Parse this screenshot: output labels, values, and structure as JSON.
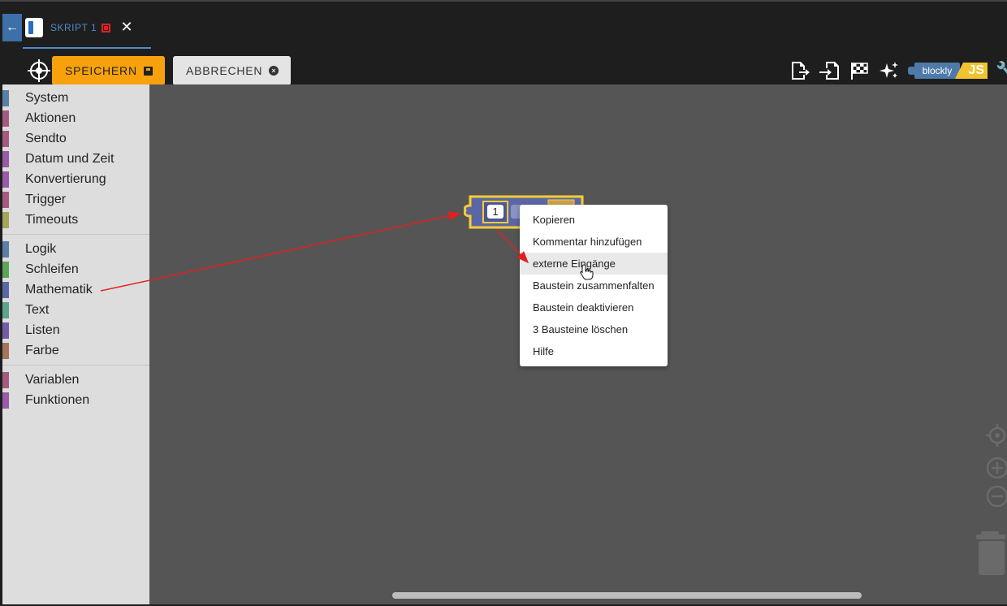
{
  "tab": {
    "title": "SKRIPT 1"
  },
  "toolbar": {
    "save_label": "SPEICHERN",
    "cancel_label": "ABBRECHEN",
    "blockly_label": "blockly",
    "js_label": "JS"
  },
  "sidebar": {
    "groups": [
      [
        {
          "label": "System",
          "color": "#5b80a5"
        },
        {
          "label": "Aktionen",
          "color": "#a55b80"
        },
        {
          "label": "Sendto",
          "color": "#a55b80"
        },
        {
          "label": "Datum und Zeit",
          "color": "#995ba5"
        },
        {
          "label": "Konvertierung",
          "color": "#995ba5"
        },
        {
          "label": "Trigger",
          "color": "#a55b80"
        },
        {
          "label": "Timeouts",
          "color": "#a5a55b"
        }
      ],
      [
        {
          "label": "Logik",
          "color": "#5b80a5"
        },
        {
          "label": "Schleifen",
          "color": "#5ba55b"
        },
        {
          "label": "Mathematik",
          "color": "#5b67a5"
        },
        {
          "label": "Text",
          "color": "#5ba58c"
        },
        {
          "label": "Listen",
          "color": "#745ba5"
        },
        {
          "label": "Farbe",
          "color": "#a5745b"
        }
      ],
      [
        {
          "label": "Variablen",
          "color": "#a55b80"
        },
        {
          "label": "Funktionen",
          "color": "#995ba5"
        }
      ]
    ]
  },
  "block": {
    "number_value": "1"
  },
  "context_menu": {
    "items": [
      {
        "label": "Kopieren",
        "hover": false
      },
      {
        "label": "Kommentar hinzufügen",
        "hover": false
      },
      {
        "label": "externe Eingänge",
        "hover": true
      },
      {
        "label": "Baustein zusammenfalten",
        "hover": false
      },
      {
        "label": "Baustein deaktivieren",
        "hover": false
      },
      {
        "label": "3 Bausteine löschen",
        "hover": false
      },
      {
        "label": "Hilfe",
        "hover": false
      }
    ]
  },
  "colors": {
    "accent_save": "#f7a10c",
    "tab_accent": "#4f8ac9",
    "workspace_bg": "#555555",
    "annotation_arrow": "#e02020",
    "block_math": "#5b67a5",
    "block_selected": "#fc3"
  }
}
